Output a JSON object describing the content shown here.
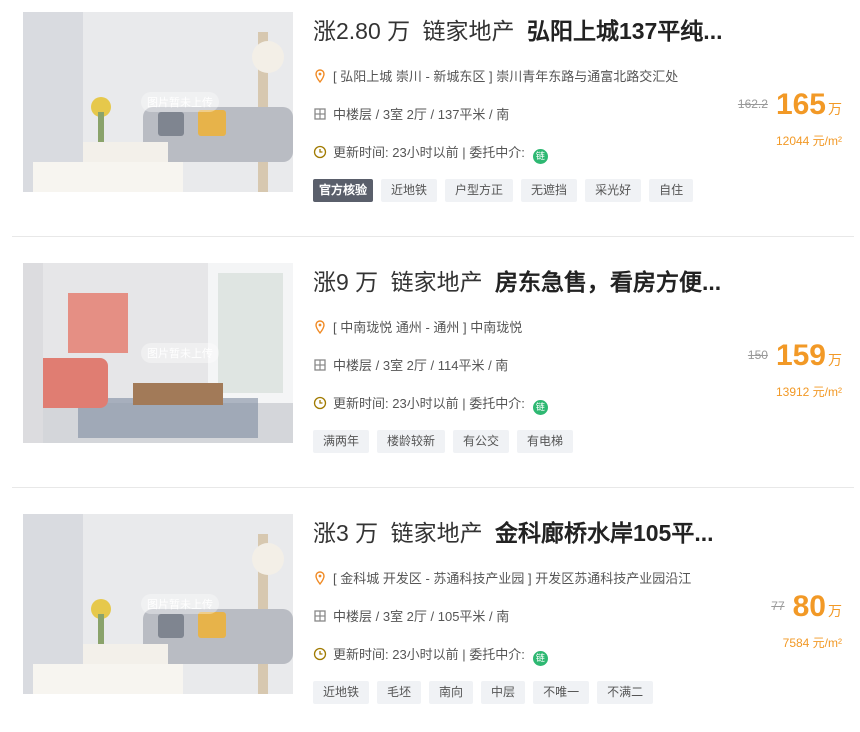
{
  "listings": [
    {
      "rise": "涨2.80 万",
      "agency": "链家地产",
      "name": "弘阳上城137平纯...",
      "location": "[ 弘阳上城 崇川 - 新城东区 ] 崇川青年东路与通富北路交汇处",
      "layout": "中楼层 / 3室 2厅 / 137平米 / 南",
      "updated": "更新时间:  23小时以前 | 委托中介:",
      "agent_badge": "链",
      "watermark": "图片暂未上传",
      "old_price": "162.2",
      "price": "165",
      "price_unit": "万",
      "unit_price": "12044 元/m²",
      "tags": [
        "官方核验",
        "近地铁",
        "户型方正",
        "无遮挡",
        "采光好",
        "自住"
      ],
      "photo_icon": "living-room-photo"
    },
    {
      "rise": "涨9 万",
      "agency": "链家地产",
      "name": "房东急售，看房方便...",
      "location": "[ 中南珑悦 通州 - 通州 ] 中南珑悦",
      "layout": "中楼层 / 3室 2厅 / 114平米 / 南",
      "updated": "更新时间:  23小时以前 | 委托中介:",
      "agent_badge": "链",
      "watermark": "图片暂未上传",
      "old_price": "150",
      "price": "159",
      "price_unit": "万",
      "unit_price": "13912 元/m²",
      "tags": [
        "满两年",
        "楼龄较新",
        "有公交",
        "有电梯"
      ],
      "photo_icon": "pink-sofa-room-photo"
    },
    {
      "rise": "涨3 万",
      "agency": "链家地产",
      "name": "金科廊桥水岸105平...",
      "location": "[ 金科城 开发区 - 苏通科技产业园 ] 开发区苏通科技产业园沿江",
      "layout": "中楼层 / 3室 2厅 / 105平米 / 南",
      "updated": "更新时间:  23小时以前 | 委托中介:",
      "agent_badge": "链",
      "watermark": "图片暂未上传",
      "old_price": "77",
      "price": "80",
      "price_unit": "万",
      "unit_price": "7584 元/m²",
      "tags": [
        "近地铁",
        "毛坯",
        "南向",
        "中层",
        "不唯一",
        "不满二"
      ],
      "photo_icon": "living-room-photo"
    }
  ],
  "colors": {
    "accent": "#f29926",
    "tag_bg": "#f0f2f5",
    "official_tag_bg": "#5a5f6b",
    "agent_green": "#2eb872"
  }
}
